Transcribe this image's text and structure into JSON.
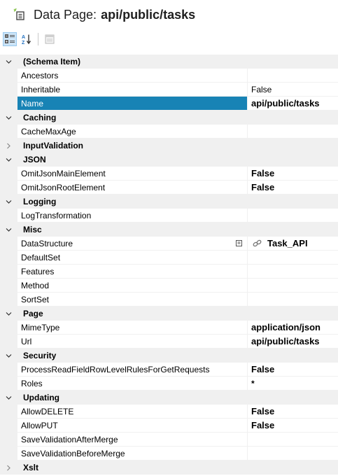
{
  "header": {
    "title_prefix": "Data Page:",
    "title_name": "api/public/tasks"
  },
  "toolbar": {
    "buttons": [
      {
        "name": "categorized-view",
        "icon": "categorized-icon",
        "active": true
      },
      {
        "name": "alphabetical-view",
        "icon": "sort-az-icon",
        "active": false
      },
      {
        "name": "property-pages",
        "icon": "property-pages-icon",
        "active": false
      }
    ]
  },
  "colors": {
    "selected_row": "#1883b5",
    "category_bg": "#f0f0f0",
    "toolbar_active": "#cce4f7"
  },
  "categories": [
    {
      "label": "(Schema Item)",
      "expanded": true,
      "props": [
        {
          "name": "Ancestors",
          "value": ""
        },
        {
          "name": "Inheritable",
          "value": "False",
          "bold": false
        },
        {
          "name": "Name",
          "value": "api/public/tasks",
          "bold": true,
          "selected": true
        }
      ]
    },
    {
      "label": "Caching",
      "expanded": true,
      "props": [
        {
          "name": "CacheMaxAge",
          "value": ""
        }
      ]
    },
    {
      "label": "InputValidation",
      "expanded": false,
      "props": []
    },
    {
      "label": "JSON",
      "expanded": true,
      "props": [
        {
          "name": "OmitJsonMainElement",
          "value": "False",
          "bold": true
        },
        {
          "name": "OmitJsonRootElement",
          "value": "False",
          "bold": true
        }
      ]
    },
    {
      "label": "Logging",
      "expanded": true,
      "props": [
        {
          "name": "LogTransformation",
          "value": ""
        }
      ]
    },
    {
      "label": "Misc",
      "expanded": true,
      "props": [
        {
          "name": "DataStructure",
          "value": "Task_API",
          "bold": true,
          "link": true,
          "ellipsis": true
        },
        {
          "name": "DefaultSet",
          "value": ""
        },
        {
          "name": "Features",
          "value": ""
        },
        {
          "name": "Method",
          "value": ""
        },
        {
          "name": "SortSet",
          "value": ""
        }
      ]
    },
    {
      "label": "Page",
      "expanded": true,
      "props": [
        {
          "name": "MimeType",
          "value": "application/json",
          "bold": true
        },
        {
          "name": "Url",
          "value": "api/public/tasks",
          "bold": true
        }
      ]
    },
    {
      "label": "Security",
      "expanded": true,
      "props": [
        {
          "name": "ProcessReadFieldRowLevelRulesForGetRequests",
          "value": "False",
          "bold": true
        },
        {
          "name": "Roles",
          "value": "*",
          "bold": true
        }
      ]
    },
    {
      "label": "Updating",
      "expanded": true,
      "props": [
        {
          "name": "AllowDELETE",
          "value": "False",
          "bold": true
        },
        {
          "name": "AllowPUT",
          "value": "False",
          "bold": true
        },
        {
          "name": "SaveValidationAfterMerge",
          "value": ""
        },
        {
          "name": "SaveValidationBeforeMerge",
          "value": ""
        }
      ]
    },
    {
      "label": "Xslt",
      "expanded": false,
      "props": []
    }
  ]
}
